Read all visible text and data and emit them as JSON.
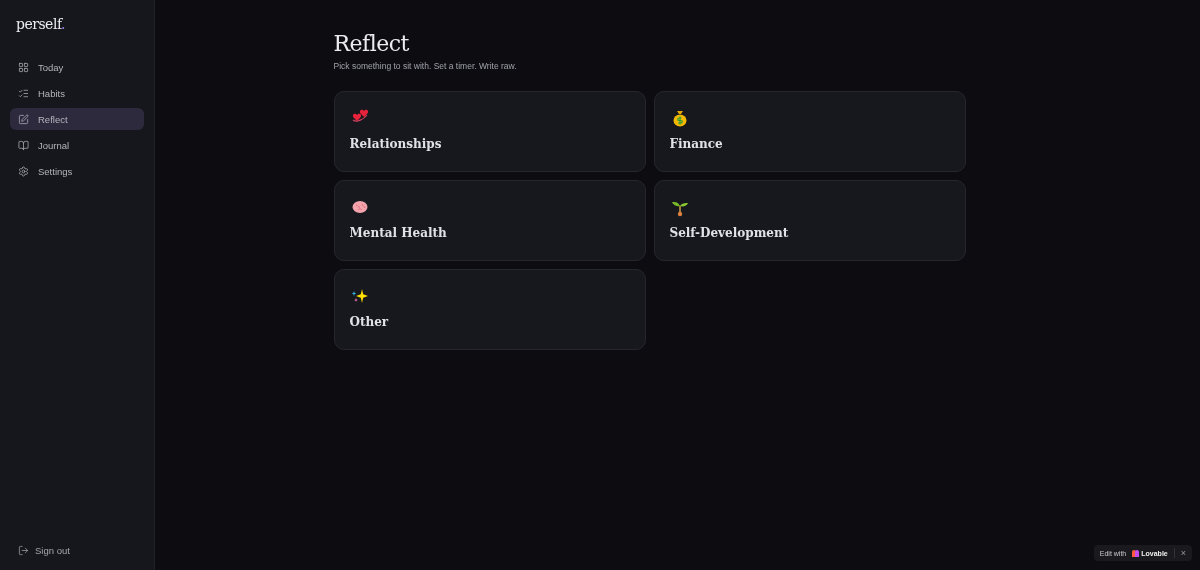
{
  "brand": {
    "name": "perself",
    "mark": "."
  },
  "nav": [
    {
      "label": "Today",
      "selected": false
    },
    {
      "label": "Habits",
      "selected": false
    },
    {
      "label": "Reflect",
      "selected": true
    },
    {
      "label": "Journal",
      "selected": false
    },
    {
      "label": "Settings",
      "selected": false
    }
  ],
  "sign_out": "Sign out",
  "page": {
    "title": "Reflect",
    "subtitle": "Pick something to sit with. Set a timer. Write raw."
  },
  "topics": [
    {
      "label": "Relationships"
    },
    {
      "label": "Finance"
    },
    {
      "label": "Mental Health"
    },
    {
      "label": "Self-Development"
    },
    {
      "label": "Other"
    }
  ],
  "badge": {
    "prefix": "Edit with",
    "brand": "Lovable",
    "close": "×"
  }
}
